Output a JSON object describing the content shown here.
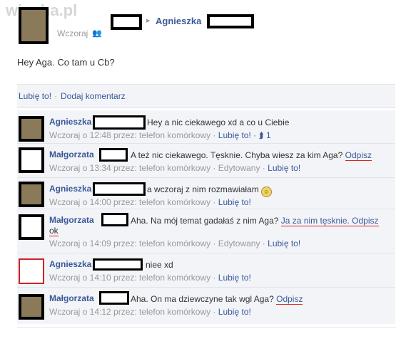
{
  "watermark": "wiocha.pl",
  "post": {
    "arrow": "▸",
    "target_name": "Agnieszka",
    "time": "Wczoraj",
    "text": "Hey Aga. Co tam u Cb?"
  },
  "actions": {
    "like": "Lubię to!",
    "separator": "·",
    "comment": "Dodaj komentarz"
  },
  "comments": [
    {
      "name": "Agnieszka",
      "text": "Hey a nic ciekawego xd a co u Ciebie",
      "meta_prefix": "Wczoraj o 12:48 przez: telefon komórkowy ·",
      "like": "Lubię to!",
      "extra": "· ⮭ 1"
    },
    {
      "name": "Małgorzata",
      "text": "A też nic ciekawego. Tęsknie. Chyba wiesz za kim Aga?",
      "reply": "Odpisz",
      "meta_prefix": "Wczoraj o 13:34 przez: telefon komórkowy · Edytowany ·",
      "like": "Lubię to!"
    },
    {
      "name": "Agnieszka",
      "text": "a wczoraj z nim rozmawiałam",
      "meta_prefix": "Wczoraj o 14:00 przez: telefon komórkowy ·",
      "like": "Lubię to!"
    },
    {
      "name": "Małgorzata",
      "text": "Aha. Na mój temat gadałaś z nim Aga?",
      "reply": "Ja za nim tęsknie. Odpisz",
      "reply2": "ok",
      "meta_prefix": "Wczoraj o 14:09 przez: telefon komórkowy · Edytowany ·",
      "like": "Lubię to!"
    },
    {
      "name": "Agnieszka",
      "text": "niee xd",
      "meta_prefix": "Wczoraj o 14:10 przez: telefon komórkowy ·",
      "like": "Lubię to!"
    },
    {
      "name": "Małgorzata",
      "text": "Aha. On ma dziewczyne tak wgl Aga?",
      "reply": "Odpisz",
      "meta_prefix": "Wczoraj o 14:12 przez: telefon komórkowy ·",
      "like": "Lubię to!"
    }
  ]
}
